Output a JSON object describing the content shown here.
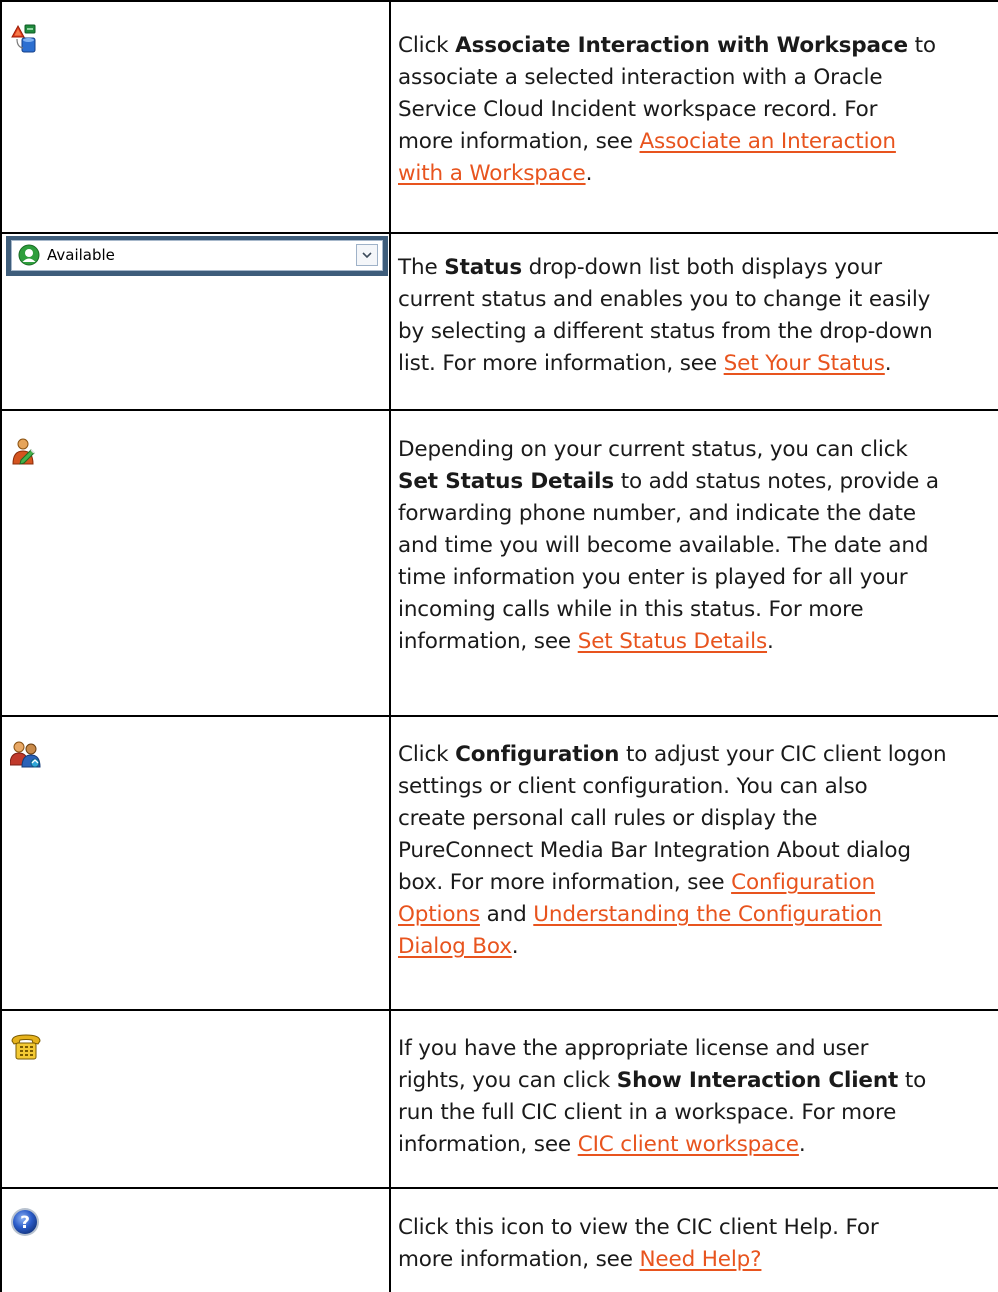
{
  "rows": [
    {
      "icon": "associate-interaction-icon",
      "segments": [
        {
          "t": "Click "
        },
        {
          "t": "Associate Interaction with Workspace",
          "b": true
        },
        {
          "t": " to"
        },
        {
          "br": true
        },
        {
          "t": "associate a selected interaction with a Oracle"
        },
        {
          "br": true
        },
        {
          "t": "Service Cloud Incident workspace record. For"
        },
        {
          "br": true
        },
        {
          "t": "more information, see "
        },
        {
          "t": "Associate an Interaction",
          "link": true
        },
        {
          "br": true
        },
        {
          "t": "with a Workspace",
          "link": true
        },
        {
          "t": "."
        }
      ]
    },
    {
      "icon": "status-dropdown",
      "status_label": "Available",
      "segments": [
        {
          "t": "The "
        },
        {
          "t": "Status",
          "b": true
        },
        {
          "t": " drop-down list both displays your"
        },
        {
          "br": true
        },
        {
          "t": "current status and enables you to change it easily"
        },
        {
          "br": true
        },
        {
          "t": "by selecting a different status from the drop-down"
        },
        {
          "br": true
        },
        {
          "t": "list. For more information, see "
        },
        {
          "t": "Set Your Status",
          "link": true
        },
        {
          "t": "."
        }
      ]
    },
    {
      "icon": "set-status-details-icon",
      "segments": [
        {
          "t": "Depending on your current status, you can click"
        },
        {
          "br": true
        },
        {
          "t": "Set Status Details",
          "b": true
        },
        {
          "t": " to add status notes, provide a"
        },
        {
          "br": true
        },
        {
          "t": "forwarding phone number, and indicate the date"
        },
        {
          "br": true
        },
        {
          "t": "and time you will become available. The date and"
        },
        {
          "br": true
        },
        {
          "t": "time information you enter is played for all your"
        },
        {
          "br": true
        },
        {
          "t": "incoming calls while in this status. For more"
        },
        {
          "br": true
        },
        {
          "t": "information, see "
        },
        {
          "t": "Set Status Details",
          "link": true
        },
        {
          "t": "."
        }
      ]
    },
    {
      "icon": "configuration-icon",
      "segments": [
        {
          "t": "Click "
        },
        {
          "t": "Configuration",
          "b": true
        },
        {
          "t": " to adjust your CIC client logon"
        },
        {
          "br": true
        },
        {
          "t": "settings or client configuration. You can also"
        },
        {
          "br": true
        },
        {
          "t": "create personal call rules or display the"
        },
        {
          "br": true
        },
        {
          "t": "PureConnect Media Bar Integration About dialog"
        },
        {
          "br": true
        },
        {
          "t": "box. For more information, see "
        },
        {
          "t": "Configuration",
          "link": true
        },
        {
          "br": true
        },
        {
          "t": "Options",
          "link": true
        },
        {
          "t": " and "
        },
        {
          "t": "Understanding the Configuration",
          "link": true
        },
        {
          "br": true
        },
        {
          "t": "Dialog Box",
          "link": true
        },
        {
          "t": "."
        }
      ]
    },
    {
      "icon": "show-interaction-client-icon",
      "segments": [
        {
          "t": "If you have the appropriate license and user"
        },
        {
          "br": true
        },
        {
          "t": "rights, you can click "
        },
        {
          "t": "Show Interaction Client",
          "b": true
        },
        {
          "t": " to"
        },
        {
          "br": true
        },
        {
          "t": "run the full CIC client in a workspace. For more"
        },
        {
          "br": true
        },
        {
          "t": "information, see "
        },
        {
          "t": "CIC client workspace",
          "link": true
        },
        {
          "t": "."
        }
      ]
    },
    {
      "icon": "help-icon",
      "segments": [
        {
          "t": "Click this icon to view the CIC client Help. For"
        },
        {
          "br": true
        },
        {
          "t": "more information, see "
        },
        {
          "t": "Need Help?",
          "link": true
        }
      ]
    }
  ]
}
